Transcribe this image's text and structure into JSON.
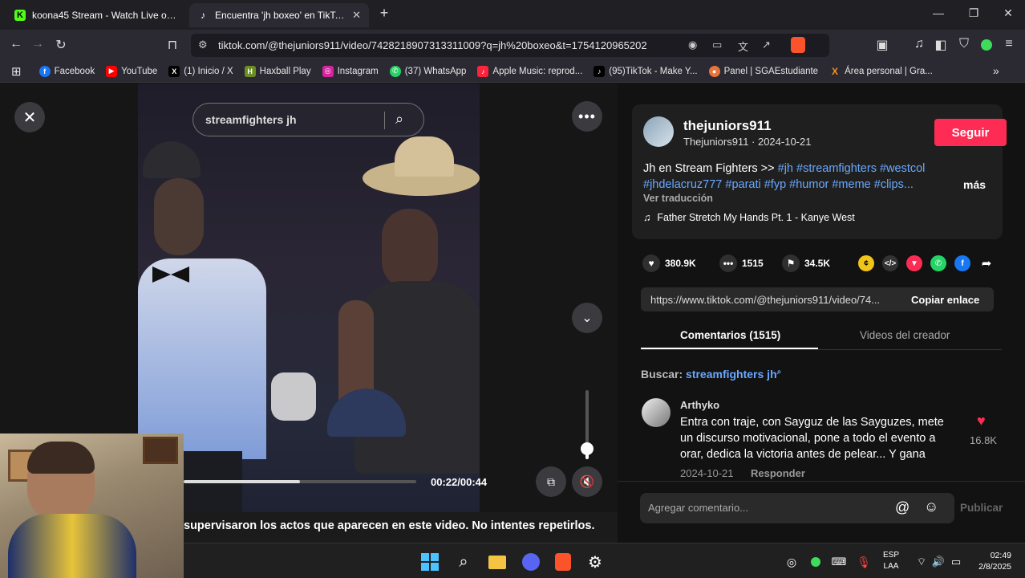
{
  "browser": {
    "tabs": [
      {
        "label": "koona45 Stream - Watch Live on Kick",
        "favicon": "K",
        "active": false
      },
      {
        "label": "Encuentra 'jh boxeo' en TikTok |",
        "favicon": "tiktok",
        "active": true
      }
    ],
    "new_tab": "+",
    "url": "tiktok.com/@thejuniors911/video/7428218907313311009?q=jh%20boxeo&t=1754120965202",
    "bookmarks": [
      {
        "label": "Facebook",
        "color": "#1877f2",
        "glyph": "f"
      },
      {
        "label": "YouTube",
        "color": "#ff0000",
        "glyph": "▶"
      },
      {
        "label": "(1) Inicio / X",
        "color": "#000000",
        "glyph": "X"
      },
      {
        "label": "Haxball Play",
        "color": "#6b8e23",
        "glyph": "H"
      },
      {
        "label": "Instagram",
        "color": "#d6249f",
        "glyph": "◎"
      },
      {
        "label": "(37) WhatsApp",
        "color": "#25d366",
        "glyph": "✆"
      },
      {
        "label": "Apple Music: reprod...",
        "color": "#fa243c",
        "glyph": "♪"
      },
      {
        "label": "(95)TikTok - Make Y...",
        "color": "#000000",
        "glyph": "♪"
      },
      {
        "label": "Panel | SGAEstudiante",
        "color": "#e8743b",
        "glyph": "●"
      },
      {
        "label": "Área personal | Gra...",
        "color": "#f7931e",
        "glyph": "X"
      }
    ]
  },
  "video": {
    "search_text": "streamfighters jh",
    "time": "00:22/00:44",
    "progress": 0.5,
    "volume": 0.15,
    "caption": "supervisaron los actos que aparecen en este video. No intentes repetirlos."
  },
  "post": {
    "username": "thejuniors911",
    "subline": "Thejuniors911 · 2024-10-21",
    "follow": "Seguir",
    "desc_text": "Jh en Stream Fighters >> ",
    "hashtags_line1": "#jh #streamfighters #westcol",
    "hashtags_line2": "#jhdelacruz777 #parati #fyp #humor #meme #clips...",
    "more": "más",
    "translate": "Ver traducción",
    "music": "Father Stretch My Hands Pt. 1 - Kanye West",
    "likes": "380.9K",
    "comments_count": "1515",
    "saves": "34.5K",
    "link": "https://www.tiktok.com/@thejuniors911/video/74...",
    "copy_link": "Copiar enlace",
    "tab_comments": "Comentarios (1515)",
    "tab_videos": "Videos del creador",
    "search_label": "Buscar: ",
    "search_value": "streamfighters jh",
    "comment": {
      "author": "Arthyko",
      "line1": "Entra con traje, con Sayguz de las Sayguzes, mete",
      "line2": "un discurso motivacional, pone a todo el evento a",
      "line3": "orar, dedica la victoria antes de pelear... Y gana",
      "date": "2024-10-21",
      "reply": "Responder",
      "likes": "16.8K"
    },
    "compose_placeholder": "Agregar comentario...",
    "publish": "Publicar"
  },
  "taskbar": {
    "lang1": "ESP",
    "lang2": "LAA",
    "time": "02:49",
    "date": "2/8/2025"
  }
}
